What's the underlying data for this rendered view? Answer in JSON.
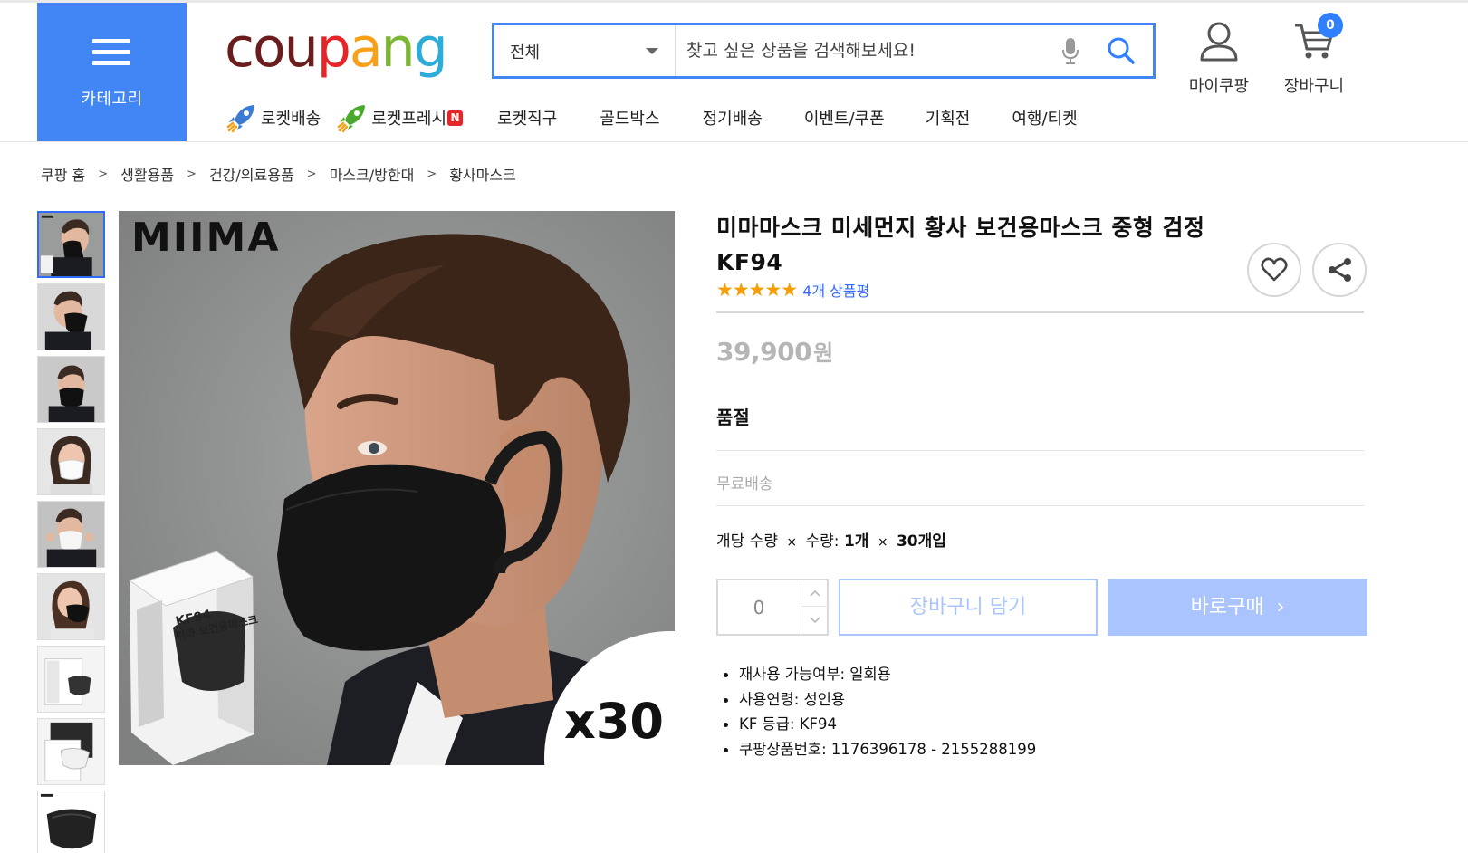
{
  "header": {
    "category_label": "카테고리",
    "logo_letters": [
      {
        "ch": "c",
        "color": "#6b1d1d"
      },
      {
        "ch": "o",
        "color": "#6b1d1d"
      },
      {
        "ch": "u",
        "color": "#6b1d1d"
      },
      {
        "ch": "p",
        "color": "#e52528"
      },
      {
        "ch": "a",
        "color": "#f7a11a"
      },
      {
        "ch": "n",
        "color": "#7bb531"
      },
      {
        "ch": "g",
        "color": "#2bacd9"
      }
    ],
    "search": {
      "category": "전체",
      "placeholder": "찾고 싶은 상품을 검색해보세요!",
      "value": ""
    },
    "my_coupang": "마이쿠팡",
    "cart_label": "장바구니",
    "cart_count": "0",
    "nav": [
      {
        "label": "로켓배송",
        "icon": "rocket-blue-icon"
      },
      {
        "label": "로켓프레시",
        "icon": "rocket-green-icon",
        "badge": "N"
      },
      {
        "label": "로켓직구"
      },
      {
        "label": "골드박스"
      },
      {
        "label": "정기배송"
      },
      {
        "label": "이벤트/쿠폰"
      },
      {
        "label": "기획전"
      },
      {
        "label": "여행/티켓"
      }
    ]
  },
  "breadcrumb": [
    "쿠팡 홈",
    "생활용품",
    "건강/의료용품",
    "마스크/방한대",
    "황사마스크"
  ],
  "breadcrumb_sep": ">",
  "product": {
    "title": "미마마스크 미세먼지 황사 보건용마스크 중형 검정 KF94",
    "stars": "★★★★★",
    "rating": 5,
    "review_text": "4개 상품평",
    "price": "39,900",
    "price_unit": "원",
    "status": "품절",
    "shipping": "무료배송",
    "qty_info": {
      "unit_label": "개당 수량",
      "times": "×",
      "qty_label": "수량:",
      "qty": "1개",
      "pack": "30개입"
    },
    "quantity": "0",
    "add_to_cart": "장바구니 담기",
    "buy_now": "바로구매",
    "buy_arrow": "›",
    "specs": [
      "재사용 가능여부: 일회용",
      "사용연령: 성인용",
      "KF 등급: KF94",
      "쿠팡상품번호: 1176396178 - 2155288199"
    ]
  },
  "image": {
    "brand": "MIIMA",
    "count_badge": "x30",
    "box_label_1": "KF94",
    "box_label_2": "미마 보건용마스크"
  },
  "colors": {
    "primary_blue": "#4285f4",
    "link_blue": "#346aff",
    "star": "#f79d00",
    "button_disabled": "#a9c4ff"
  }
}
